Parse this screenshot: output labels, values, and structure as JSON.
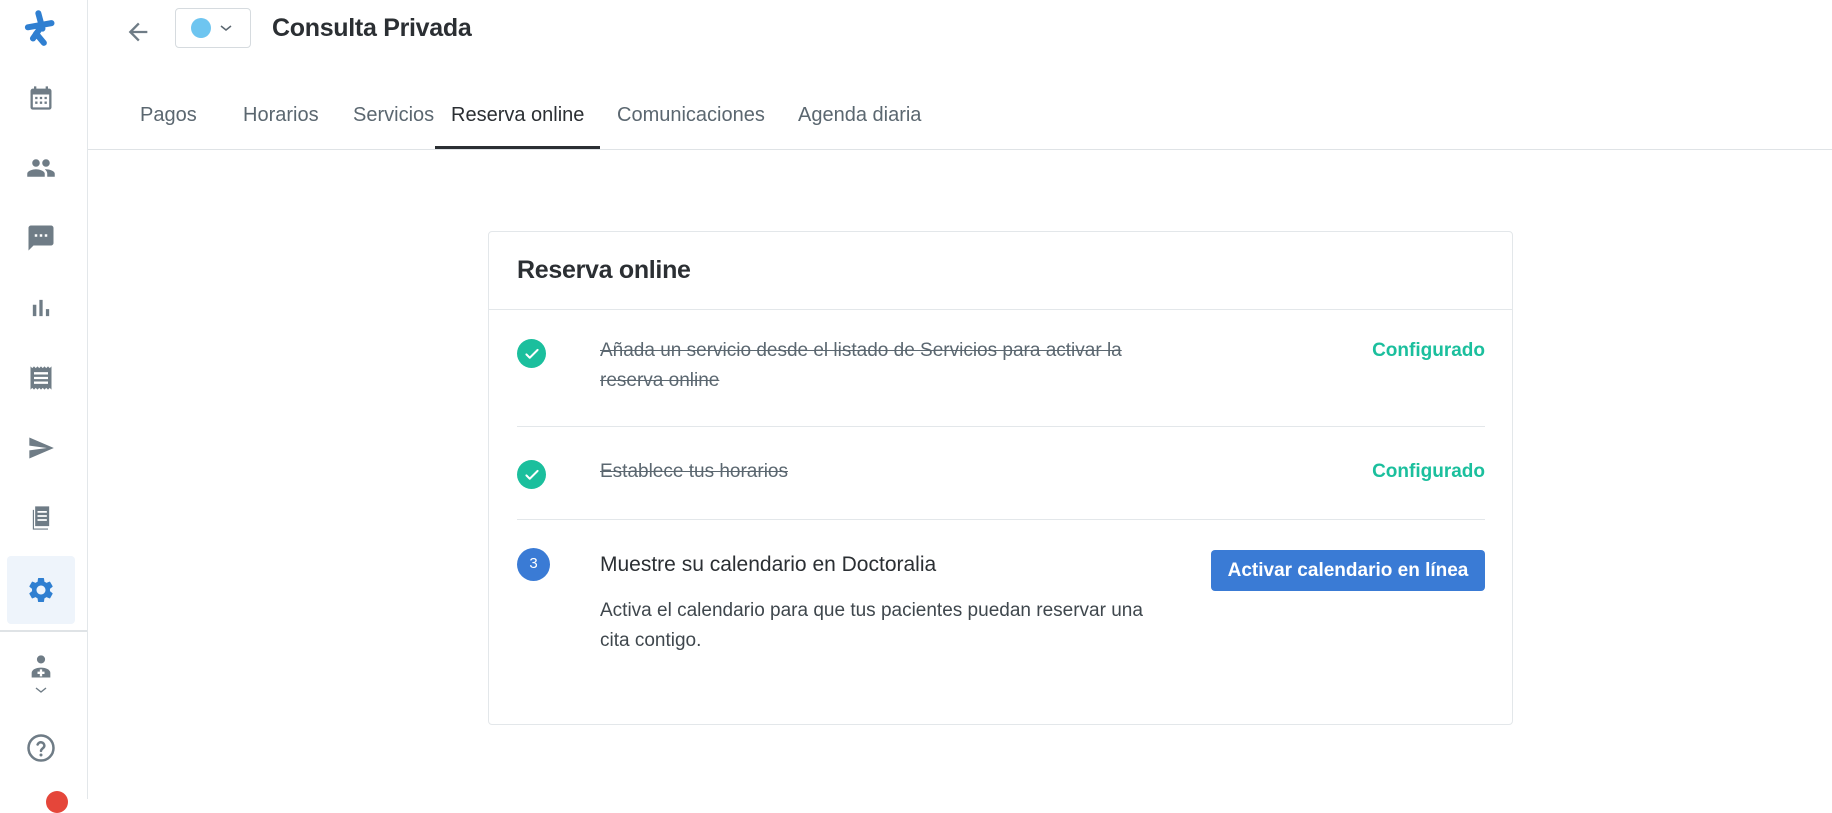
{
  "header": {
    "title": "Consulta Privada",
    "color_select": {
      "selected_color": "#6ec5f0"
    }
  },
  "sidebar": {
    "items": [
      {
        "icon": "logo-icon"
      },
      {
        "icon": "calendar-icon"
      },
      {
        "icon": "patients-icon"
      },
      {
        "icon": "messages-icon"
      },
      {
        "icon": "statistics-icon"
      },
      {
        "icon": "invoices-icon"
      },
      {
        "icon": "campaigns-icon"
      },
      {
        "icon": "documents-icon"
      },
      {
        "icon": "settings-icon",
        "active": true
      },
      {
        "icon": "doctor-profile-icon"
      },
      {
        "icon": "help-icon"
      }
    ]
  },
  "tabs": [
    {
      "label": "Pagos"
    },
    {
      "label": "Horarios"
    },
    {
      "label": "Servicios"
    },
    {
      "label": "Reserva online",
      "active": true
    },
    {
      "label": "Comunicaciones"
    },
    {
      "label": "Agenda diaria"
    }
  ],
  "card": {
    "title": "Reserva online",
    "steps": [
      {
        "text": "Añada un servicio desde el listado de Servicios para activar la reserva online",
        "status": "Configurado",
        "done": true
      },
      {
        "text": "Establece tus horarios",
        "status": "Configurado",
        "done": true
      },
      {
        "number": "3",
        "title": "Muestre su calendario en Doctoralia",
        "description": "Activa el calendario para que tus pacientes puedan reservar una cita contigo.",
        "button_label": "Activar calendario en línea",
        "done": false
      }
    ]
  },
  "colors": {
    "accent": "#3a7bd5",
    "success": "#1bbf9d",
    "brand": "#2f7fd1"
  }
}
